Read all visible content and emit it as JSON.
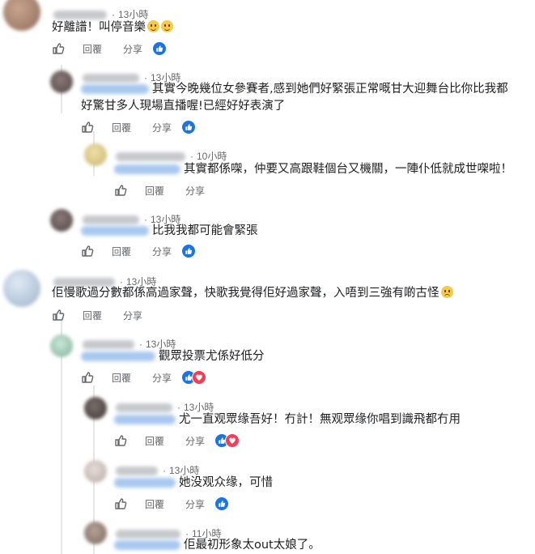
{
  "actions": {
    "reply_label": "回覆",
    "share_label": "分享"
  },
  "comments": [
    {
      "time": "13小時",
      "text": "好離譜！叫停音樂",
      "emoji": [
        "smirk-emoji",
        "smirk-emoji"
      ],
      "reactions": [
        "like"
      ]
    },
    {
      "time": "13小時",
      "text_line1": "其實今晚幾位女參賽者,感到她們好緊張正常嘅甘大迎舞台比你比我都",
      "text_line2": "好驚甘多人現場直播喔!已經好好表演了",
      "reactions": [
        "like"
      ]
    },
    {
      "time": "10小時",
      "text": "其實都係㗎，仲要又高跟鞋個台又機關，一陣仆低就成世㗎啦！",
      "reactions": []
    },
    {
      "time": "13小時",
      "text": "比我我都可能會緊張",
      "reactions": [
        "like"
      ]
    },
    {
      "time": "13小時",
      "text": "佢慢歌過分數都係高過家聲，快歌我覺得佢好過家聲，入唔到三強有啲古怪",
      "emoji": [
        "worried-emoji"
      ],
      "reactions": []
    },
    {
      "time": "13小時",
      "text": "觀眾投票尤係好低分",
      "reactions": [
        "like",
        "love"
      ]
    },
    {
      "time": "13小時",
      "text": "尤一直观眾缘吾好！冇計！無观眾缘你唱到識飛都冇用",
      "reactions": [
        "like",
        "love"
      ]
    },
    {
      "time": "13小時",
      "text": "她没观众缘，可惜",
      "reactions": [
        "like"
      ]
    },
    {
      "time": "11小時",
      "text": "佢最初形象太out太娘了。",
      "reactions": []
    }
  ]
}
